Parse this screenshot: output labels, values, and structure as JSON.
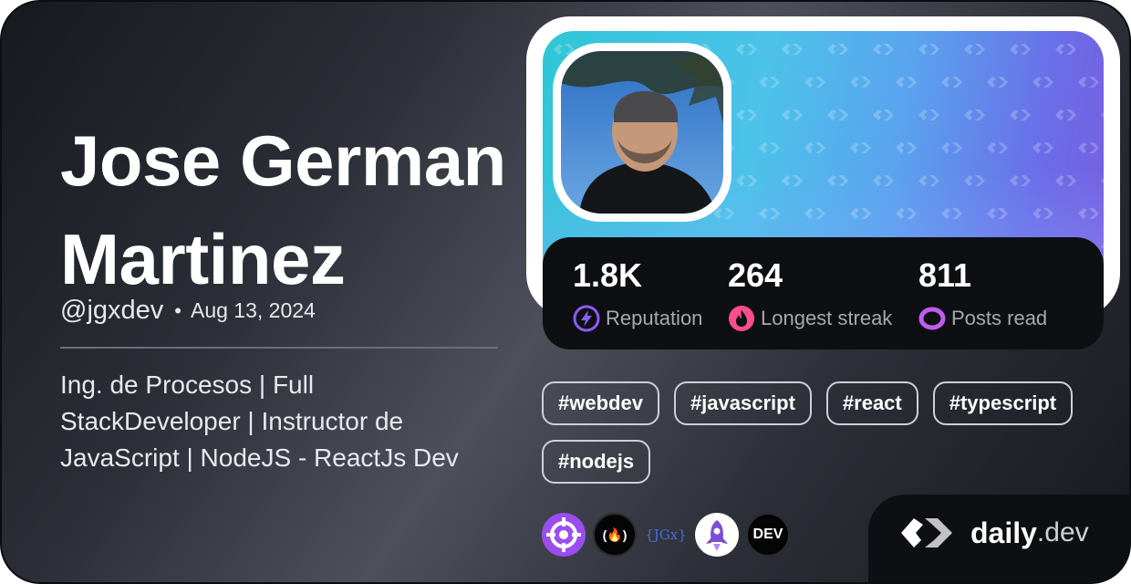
{
  "profile": {
    "name": "Jose German Martinez",
    "handle": "@jgxdev",
    "separator": "•",
    "date": "Aug 13, 2024",
    "bio": "Ing. de Procesos | Full StackDeveloper | Instructor de JavaScript | NodeJS - ReactJs Dev"
  },
  "stats": [
    {
      "value": "1.8K",
      "label": "Reputation",
      "icon": "reputation-bolt-icon",
      "color": "#8b5cf6"
    },
    {
      "value": "264",
      "label": "Longest streak",
      "icon": "streak-flame-icon",
      "color": "#ff4d8d"
    },
    {
      "value": "811",
      "label": "Posts read",
      "icon": "posts-read-ring-icon",
      "color": "#c05cf0"
    }
  ],
  "tags": [
    "#webdev",
    "#javascript",
    "#react",
    "#typescript",
    "#nodejs"
  ],
  "squads": [
    {
      "name": "target-icon"
    },
    {
      "name": "freecodecamp-icon",
      "text": "(🔥)"
    },
    {
      "name": "jgx-logo-icon",
      "text": "{JGx}"
    },
    {
      "name": "rocket-icon"
    },
    {
      "name": "dev-logo-icon",
      "text": "DEV"
    }
  ],
  "brand": {
    "word": "daily",
    "tld": ".dev"
  },
  "colors": {
    "accent": "#8b5cf6",
    "streak": "#ff4d8d",
    "posts": "#c05cf0",
    "card_bg": "#2b2e36"
  }
}
